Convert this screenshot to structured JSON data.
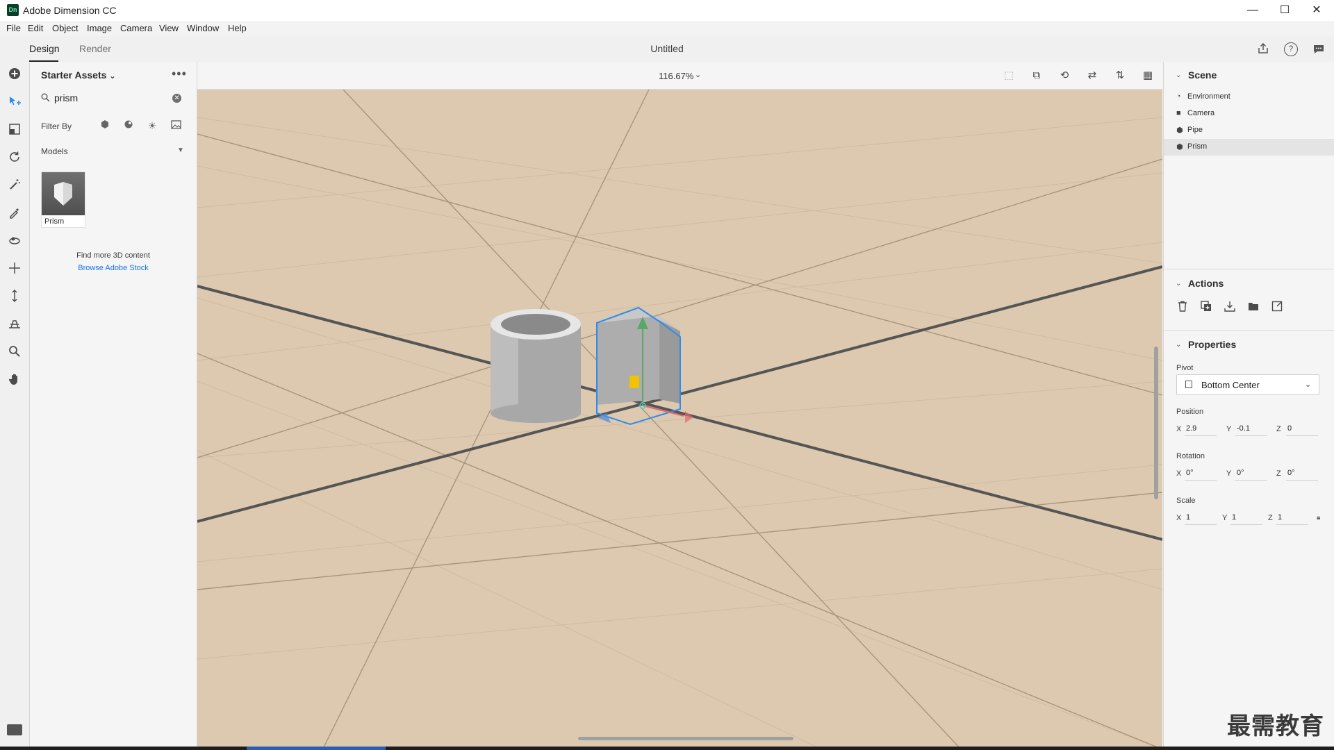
{
  "app": {
    "icon_text": "Dn",
    "title": "Adobe Dimension CC"
  },
  "window_controls": {
    "minimize": "—",
    "maximize": "☐",
    "close": "✕"
  },
  "menu": [
    "File",
    "Edit",
    "Object",
    "Image",
    "Camera",
    "View",
    "Window",
    "Help"
  ],
  "doc_tabs": {
    "design": "Design",
    "render": "Render",
    "active": "Design"
  },
  "document_title": "Untitled",
  "header_icons": [
    "share-icon",
    "help-icon",
    "feedback-icon"
  ],
  "tools": [
    "add-icon",
    "select-icon",
    "select-box-icon",
    "rotate-icon",
    "magic-wand-icon",
    "eyedropper-icon",
    "orbit-icon",
    "pan-icon",
    "dolly-icon",
    "horizon-icon",
    "zoom-icon",
    "hand-icon"
  ],
  "assets": {
    "title": "Starter Assets",
    "search_value": "prism",
    "filter_label": "Filter By",
    "section": "Models",
    "items": [
      {
        "name": "Prism"
      }
    ],
    "find_more": "Find more 3D content",
    "browse_link": "Browse Adobe Stock"
  },
  "canvas": {
    "zoom": "116.67%",
    "bg_color": "#dcc9b0",
    "selection_color": "#2d8ceb"
  },
  "scene": {
    "title": "Scene",
    "items": [
      {
        "label": "Environment",
        "icon": "environment-icon",
        "selected": false
      },
      {
        "label": "Camera",
        "icon": "camera-icon",
        "selected": false
      },
      {
        "label": "Pipe",
        "icon": "model-icon",
        "selected": false
      },
      {
        "label": "Prism",
        "icon": "model-icon",
        "selected": true
      }
    ]
  },
  "actions": {
    "title": "Actions",
    "icons": [
      "delete-icon",
      "duplicate-icon",
      "import-icon",
      "group-icon",
      "export-icon"
    ]
  },
  "properties": {
    "title": "Properties",
    "pivot_label": "Pivot",
    "pivot_value": "Bottom Center",
    "position_label": "Position",
    "position": {
      "x": "2.9",
      "y": "-0.1",
      "z": "0"
    },
    "rotation_label": "Rotation",
    "rotation": {
      "x": "0°",
      "y": "0°",
      "z": "0°"
    },
    "scale_label": "Scale",
    "scale": {
      "x": "1",
      "y": "1",
      "z": "1"
    }
  },
  "watermark": "最需教育"
}
